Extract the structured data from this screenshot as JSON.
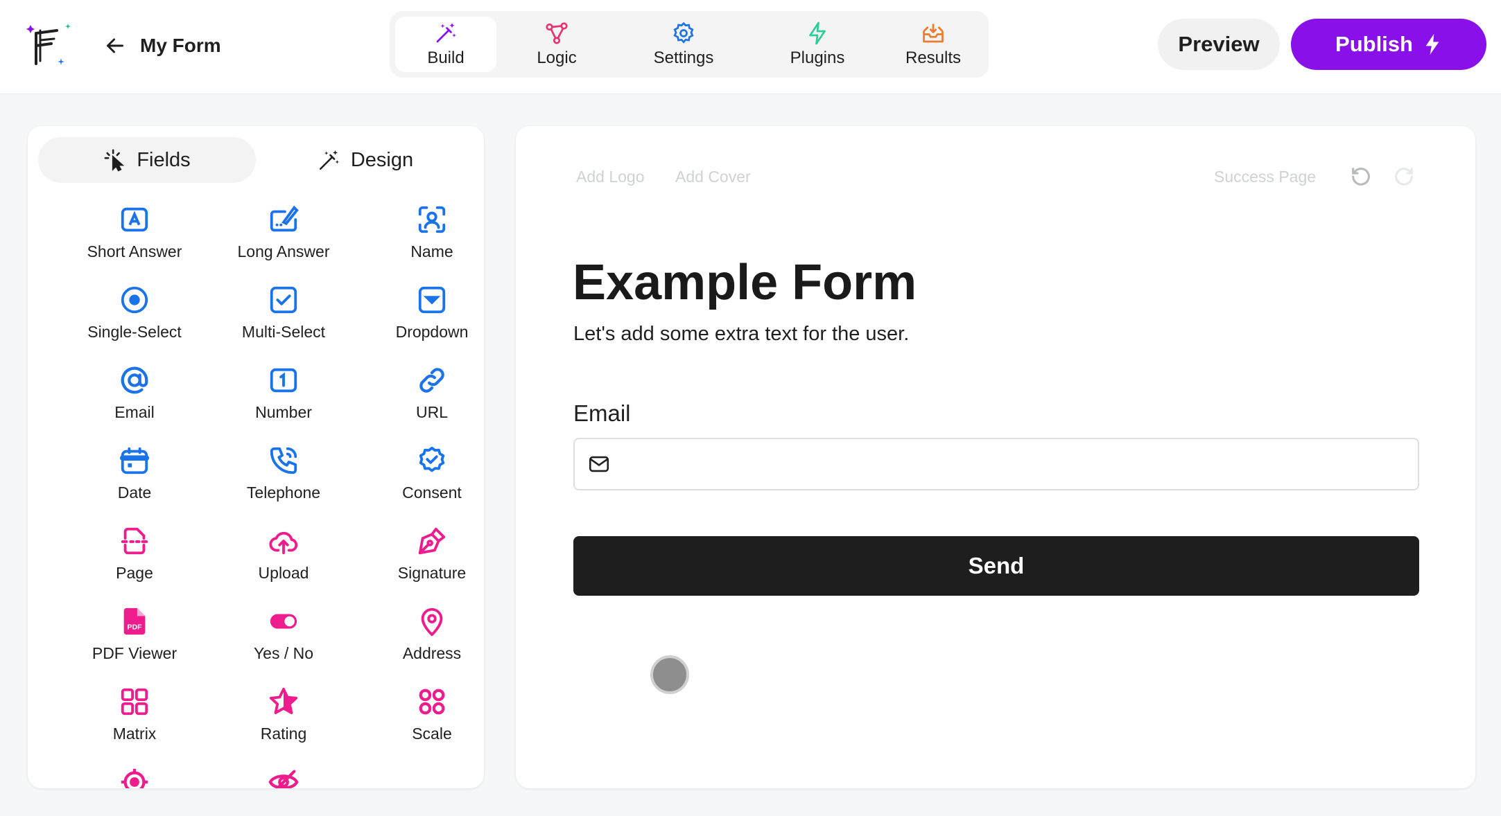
{
  "app": {
    "form_name": "My Form"
  },
  "colors": {
    "accent": "#8a10ea",
    "field_blue": "#1a73e8",
    "field_pink": "#ee1c8d",
    "logic_pink": "#e8336f",
    "plugins_green": "#2ecc9a",
    "results_orange": "#f07b2a"
  },
  "header": {
    "tabs": [
      {
        "label": "Build",
        "icon": "magic-wand-icon"
      },
      {
        "label": "Logic",
        "icon": "nodes-icon"
      },
      {
        "label": "Settings",
        "icon": "gear-icon"
      },
      {
        "label": "Plugins",
        "icon": "lightning-icon"
      },
      {
        "label": "Results",
        "icon": "inbox-icon"
      }
    ],
    "preview_label": "Preview",
    "publish_label": "Publish"
  },
  "panel": {
    "tabs": [
      {
        "label": "Fields",
        "icon": "pointer-click-icon"
      },
      {
        "label": "Design",
        "icon": "magic-wand-icon"
      }
    ],
    "fields": [
      {
        "label": "Short Answer",
        "icon": "text-box-icon"
      },
      {
        "label": "Long Answer",
        "icon": "pen-keyboard-icon"
      },
      {
        "label": "Name",
        "icon": "user-scan-icon"
      },
      {
        "label": "Single-Select",
        "icon": "radio-icon"
      },
      {
        "label": "Multi-Select",
        "icon": "checkbox-icon"
      },
      {
        "label": "Dropdown",
        "icon": "dropdown-icon"
      },
      {
        "label": "Email",
        "icon": "at-icon"
      },
      {
        "label": "Number",
        "icon": "number-box-icon"
      },
      {
        "label": "URL",
        "icon": "link-icon"
      },
      {
        "label": "Date",
        "icon": "calendar-icon"
      },
      {
        "label": "Telephone",
        "icon": "phone-icon"
      },
      {
        "label": "Consent",
        "icon": "badge-check-icon"
      },
      {
        "label": "Page",
        "icon": "page-break-icon"
      },
      {
        "label": "Upload",
        "icon": "cloud-upload-icon"
      },
      {
        "label": "Signature",
        "icon": "pen-nib-icon"
      },
      {
        "label": "PDF Viewer",
        "icon": "pdf-icon"
      },
      {
        "label": "Yes / No",
        "icon": "toggle-icon"
      },
      {
        "label": "Address",
        "icon": "map-pin-icon"
      },
      {
        "label": "Matrix",
        "icon": "grid-icon"
      },
      {
        "label": "Rating",
        "icon": "star-icon"
      },
      {
        "label": "Scale",
        "icon": "dots-grid-icon"
      }
    ],
    "pdf_badge": "PDF"
  },
  "canvas": {
    "add_logo": "Add Logo",
    "add_cover": "Add Cover",
    "success_page": "Success Page",
    "title": "Example Form",
    "description": "Let's add some extra text for the user.",
    "email_label": "Email",
    "email_value": "",
    "send_label": "Send"
  }
}
